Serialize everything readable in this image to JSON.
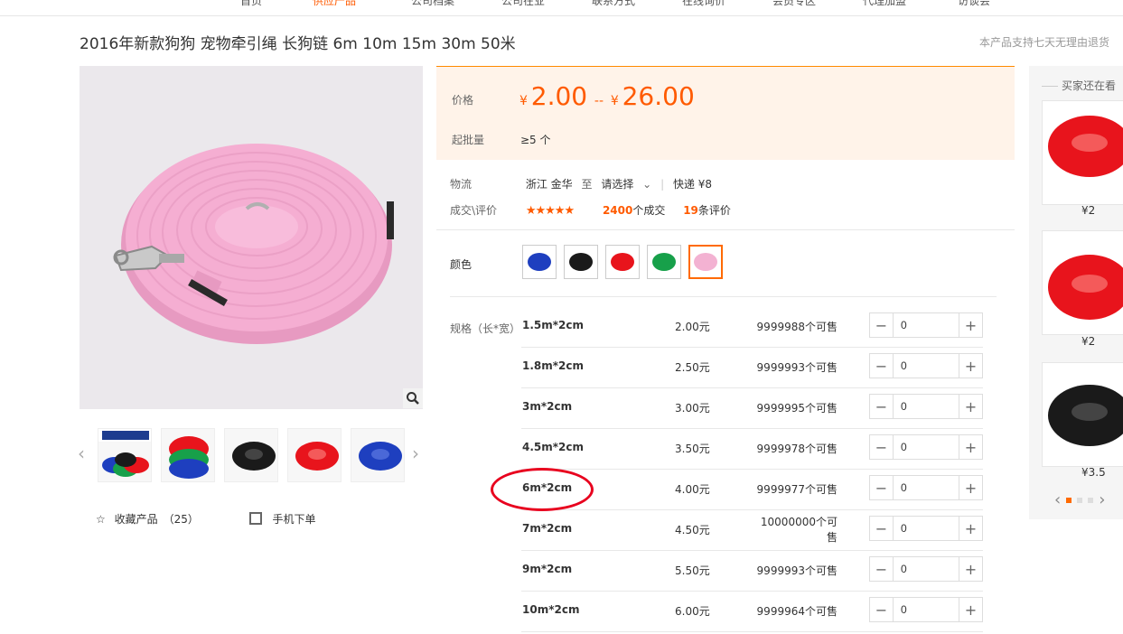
{
  "topnav": {
    "items": [
      {
        "label": "首页"
      },
      {
        "label": "供应产品",
        "active": true
      },
      {
        "label": "公司档案"
      },
      {
        "label": "公司在业"
      },
      {
        "label": "联系方式"
      },
      {
        "label": "在线询价"
      },
      {
        "label": "会员专区"
      },
      {
        "label": "代理加盟"
      },
      {
        "label": "访谈会"
      }
    ]
  },
  "product": {
    "title": "2016年新款狗狗 宠物牵引绳 长狗链 6m 10m 15m 30m 50米",
    "guarantee": "本产品支持七天无理由退货"
  },
  "gallery": {
    "thumb_count_visible": 5,
    "collect_label": "收藏产品",
    "collect_count": "（25）",
    "mobile_label": "手机下单"
  },
  "price": {
    "label": "价格",
    "currency": "¥",
    "min": "2.00",
    "sep": "--",
    "max": "26.00",
    "moq_label": "起批量",
    "moq_value": "≥5 个"
  },
  "logistics": {
    "label": "物流",
    "from": "浙江 金华",
    "to_word": "至",
    "select": "请选择",
    "express": "快递 ¥8"
  },
  "deals": {
    "label": "成交\\评价",
    "stars": "★★★★★",
    "orders_num": "2400",
    "orders_unit": "个成交",
    "reviews_num": "19",
    "reviews_unit": "条评价"
  },
  "color": {
    "label": "颜色",
    "options": [
      {
        "name": "blue",
        "color": "#1e3fbf"
      },
      {
        "name": "black",
        "color": "#1a1a1a"
      },
      {
        "name": "red",
        "color": "#e8141c"
      },
      {
        "name": "green",
        "color": "#17a04a"
      },
      {
        "name": "pink",
        "color": "#f3b2d2",
        "selected": true
      }
    ]
  },
  "spec": {
    "label": "规格（长*宽）",
    "rows": [
      {
        "name": "1.5m*2cm",
        "price": "2.00元",
        "stock": "9999988个可售",
        "qty": "0"
      },
      {
        "name": "1.8m*2cm",
        "price": "2.50元",
        "stock": "9999993个可售",
        "qty": "0"
      },
      {
        "name": "3m*2cm",
        "price": "3.00元",
        "stock": "9999995个可售",
        "qty": "0"
      },
      {
        "name": "4.5m*2cm",
        "price": "3.50元",
        "stock": "9999978个可售",
        "qty": "0"
      },
      {
        "name": "6m*2cm",
        "price": "4.00元",
        "stock": "9999977个可售",
        "qty": "0"
      },
      {
        "name": "7m*2cm",
        "price": "4.50元",
        "stock": "10000000个可售",
        "qty": "0"
      },
      {
        "name": "9m*2cm",
        "price": "5.50元",
        "stock": "9999993个可售",
        "qty": "0"
      },
      {
        "name": "10m*2cm",
        "price": "6.00元",
        "stock": "9999964个可售",
        "qty": "0"
      }
    ]
  },
  "side": {
    "title": "买家还在看",
    "items": [
      {
        "price": "¥2",
        "color": "#e8141c"
      },
      {
        "price": "¥2",
        "color": "#e8141c"
      },
      {
        "price": "¥3.5",
        "color": "#1a1a1a"
      }
    ]
  }
}
